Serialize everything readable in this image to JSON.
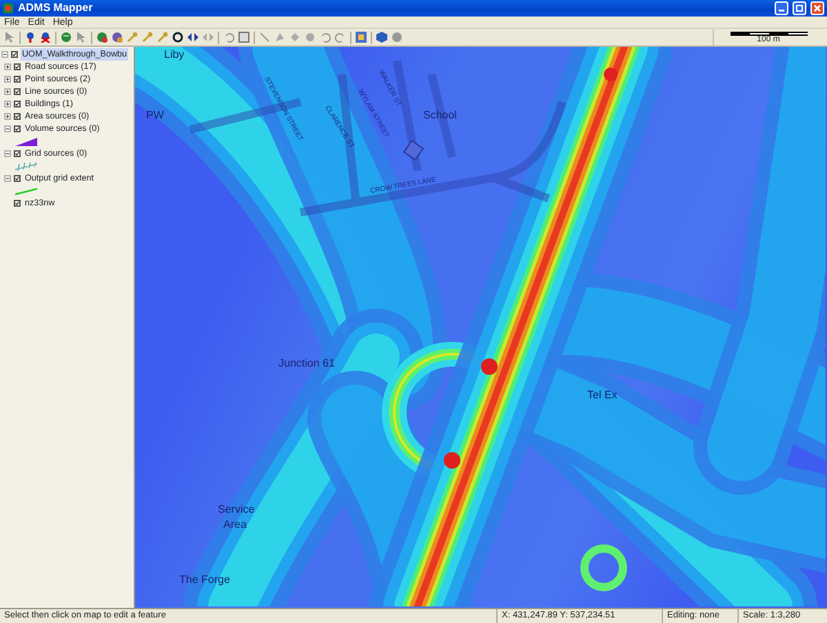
{
  "window": {
    "title": "ADMS Mapper"
  },
  "menu": [
    "File",
    "Edit",
    "Help"
  ],
  "scale_bar": {
    "label": "100 m"
  },
  "layers": [
    {
      "label": "UOM_Walkthrough_Bowbu",
      "checked": true,
      "expanded": true,
      "selected": true,
      "children": [
        {
          "label": "Road sources (17)",
          "checked": true,
          "expanded": false,
          "selected": false
        },
        {
          "label": "Point sources (2)",
          "checked": true,
          "expanded": false,
          "selected": false
        },
        {
          "label": "Line sources (0)",
          "checked": true,
          "expanded": false,
          "selected": false
        },
        {
          "label": "Buildings (1)",
          "checked": true,
          "expanded": false,
          "selected": false
        },
        {
          "label": "Area sources (0)",
          "checked": true,
          "expanded": false,
          "selected": false
        },
        {
          "label": "Volume sources (0)",
          "checked": true,
          "expanded": true,
          "selected": false,
          "kind": "wedge"
        },
        {
          "label": "Grid sources (0)",
          "checked": true,
          "expanded": true,
          "selected": false,
          "kind": "grid"
        },
        {
          "label": "Output grid extent",
          "checked": true,
          "expanded": true,
          "selected": false,
          "kind": "line"
        },
        {
          "label": "nz33nw",
          "checked": true,
          "selected": false
        }
      ]
    }
  ],
  "map_labels": [
    {
      "text": "Liby",
      "kind": "place"
    },
    {
      "text": "PW",
      "kind": "place"
    },
    {
      "text": "School",
      "kind": "place"
    },
    {
      "text": "STEVENSON STREET",
      "kind": "street"
    },
    {
      "text": "CLARENCE ST",
      "kind": "street"
    },
    {
      "text": "WYLAM STREET",
      "kind": "street"
    },
    {
      "text": "WALKER ST",
      "kind": "street"
    },
    {
      "text": "CROW TREES LANE",
      "kind": "street"
    },
    {
      "text": "Junction 61",
      "kind": "place"
    },
    {
      "text": "Tel Ex",
      "kind": "place"
    },
    {
      "text": "Service",
      "kind": "place"
    },
    {
      "text": "Area",
      "kind": "place"
    },
    {
      "text": "The Forge",
      "kind": "place"
    }
  ],
  "status_bar": {
    "hint": "Select then click on map to edit a feature",
    "coordinates": "X: 431,247.89  Y: 537,234.51",
    "editing": "Editing: none",
    "scale": "Scale: 1:3,280"
  }
}
